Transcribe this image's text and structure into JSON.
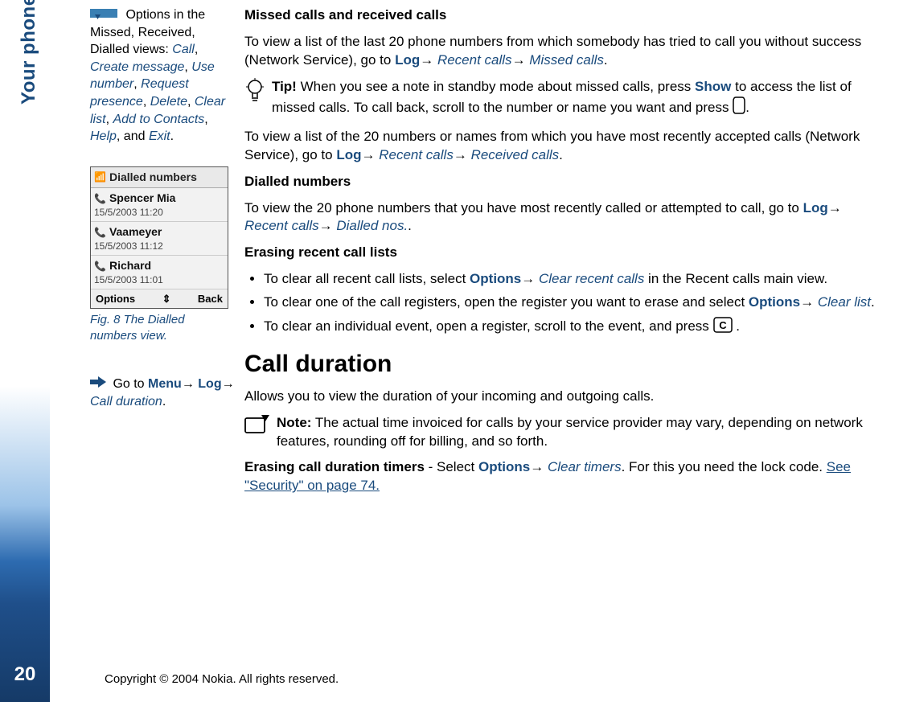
{
  "page": {
    "number": "20",
    "section_title": "Your phone",
    "copyright": "Copyright © 2004 Nokia. All rights reserved."
  },
  "arrow": "→",
  "sidebar": {
    "options": {
      "lead": " Options in the Missed, Received, Dialled views: ",
      "items": [
        "Call",
        "Create message",
        "Use number",
        "Request presence",
        "Delete",
        "Clear list",
        "Add to Contacts",
        "Help"
      ],
      "last_item": "Exit",
      "sep": ", ",
      "and": ", and ",
      "period": "."
    },
    "figure": {
      "title": "Dialled numbers",
      "rows": [
        {
          "name": "Spencer Mia",
          "date": "15/5/2003 11:20"
        },
        {
          "name": "Vaameyer",
          "date": "15/5/2003 11:12"
        },
        {
          "name": "Richard",
          "date": "15/5/2003 11:01"
        }
      ],
      "soft_left": "Options",
      "soft_mid": "⇕",
      "soft_right": "Back",
      "caption": "Fig. 8 The Dialled numbers view."
    },
    "goto": {
      "prefix": " Go to ",
      "p1": "Menu",
      "p2": "Log",
      "p3": "Call duration",
      "period": "."
    }
  },
  "main": {
    "h_missed": "Missed calls and received calls",
    "p_missed_1a": "To view a list of the last 20 phone numbers from which somebody has tried to call you without success (Network Service), go to ",
    "log": "Log",
    "recent_calls": "Recent calls",
    "missed_calls": "Missed calls",
    "period": ".",
    "tip_label": "Tip!",
    "tip_a": " When you see a note in standby mode about missed calls, press ",
    "show": "Show",
    "tip_b": " to access the list of missed calls. To call back, scroll to the number or name you want and press ",
    "p_received_a": "To view a list of the 20 numbers or names from which you have most recently accepted calls (Network Service), go to ",
    "received_calls": "Received calls",
    "h_dialled": "Dialled numbers",
    "p_dialled_a": "To view the 20 phone numbers that you have most recently called or attempted to call, go to ",
    "dialled_nos": "Dialled nos.",
    "h_erase": "Erasing recent call lists",
    "li1_a": "To clear all recent call lists, select ",
    "options": "Options",
    "clear_recent": "Clear recent calls",
    "li1_b": " in the Recent calls main view.",
    "li2_a": "To clear one of the call registers, open the register you want to erase and select ",
    "clear_list": "Clear list",
    "li3_a": "To clear an individual event, open a register, scroll to the event, and press ",
    "li3_b": " .",
    "h_callduration": "Call duration",
    "p_cd": "Allows you to view the duration of your incoming and outgoing calls.",
    "note_label": "Note:",
    "note_body": " The actual time invoiced for calls by your service provider may vary, depending on network features, rounding off for billing, and so forth.",
    "erase_timers_a": "Erasing call duration timers",
    "erase_timers_b": " - Select ",
    "clear_timers": "Clear timers",
    "erase_timers_c": ". For this you need the lock code. ",
    "see_security": "See \"Security\" on page 74."
  }
}
